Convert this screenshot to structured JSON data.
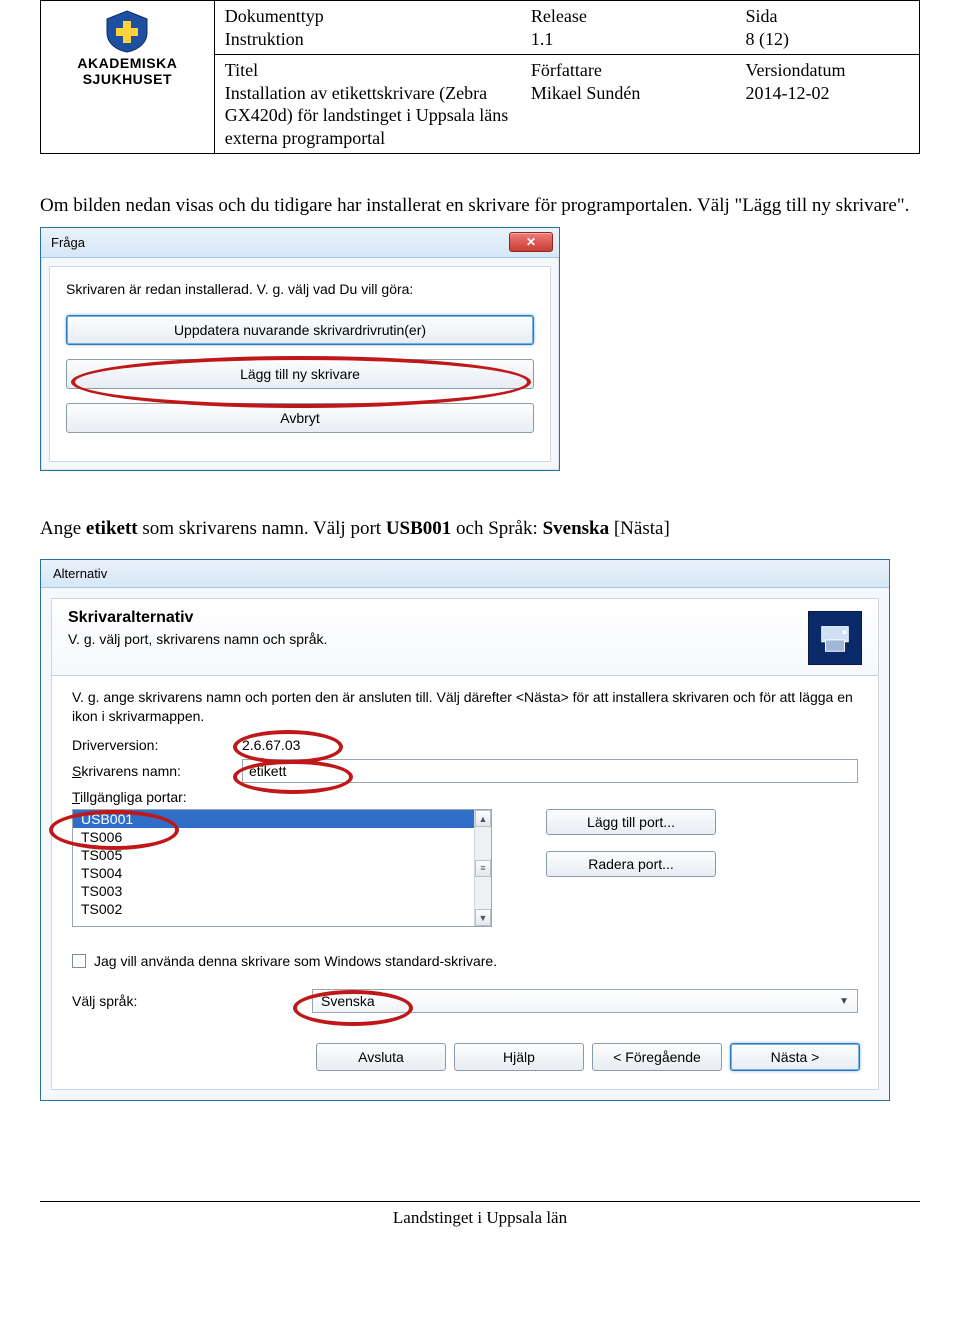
{
  "header": {
    "brand_line1": "AKADEMISKA",
    "brand_line2": "SJUKHUSET",
    "dokumenttyp_label": "Dokumenttyp",
    "dokumenttyp_value": "Instruktion",
    "release_label": "Release",
    "release_value": "1.1",
    "sida_label": "Sida",
    "sida_value": "8 (12)",
    "titel_label": "Titel",
    "titel_value": "Installation av etikettskrivare (Zebra GX420d) för landstinget i Uppsala läns externa programportal",
    "forfattare_label": "Författare",
    "forfattare_value": "Mikael Sundén",
    "versiondatum_label": "Versiondatum",
    "versiondatum_value": "2014-12-02"
  },
  "body": {
    "p1": "Om bilden nedan visas och du tidigare har installerat en skrivare för programportalen. Välj \"Lägg till ny skrivare\".",
    "p2_a": "Ange ",
    "p2_b": "etikett",
    "p2_c": " som skrivarens namn. Välj port ",
    "p2_d": "USB001",
    "p2_e": " och Språk: ",
    "p2_f": "Svenska",
    "p2_g": " [Nästa]"
  },
  "dlg1": {
    "title": "Fråga",
    "close": "✕",
    "msg": "Skrivaren är redan installerad. V. g. välj vad Du vill göra:",
    "btn_update": "Uppdatera nuvarande skrivardrivrutin(er)",
    "btn_add": "Lägg till ny skrivare",
    "btn_cancel": "Avbryt"
  },
  "dlg2": {
    "title": "Alternativ",
    "heading": "Skrivaralternativ",
    "sub": "V. g. välj port, skrivarens namn och språk.",
    "help": "V. g. ange skrivarens namn och porten den är ansluten till. Välj därefter <Nästa> för att installera skrivaren och för att lägga en ikon i skrivarmappen.",
    "driver_label": "Driverversion:",
    "driver_value": "2.6.67.03",
    "name_label_pre": "S",
    "name_label_post": "krivarens namn:",
    "name_value": "etikett",
    "ports_label_pre": "T",
    "ports_label_post": "illgängliga portar:",
    "ports": [
      "USB001",
      "TS006",
      "TS005",
      "TS004",
      "TS003",
      "TS002"
    ],
    "addport": "Lägg till port...",
    "delport": "Radera port...",
    "chk_pre": "J",
    "chk_post": "ag vill använda denna skrivare som Windows standard-skrivare.",
    "lang_label": "Välj språk:",
    "lang_value": "Svenska",
    "btn_exit": "Avsluta",
    "btn_help": "Hjälp",
    "btn_prev": "< Föregående",
    "btn_next": "Nästa >"
  },
  "footer": "Landstinget i Uppsala län"
}
